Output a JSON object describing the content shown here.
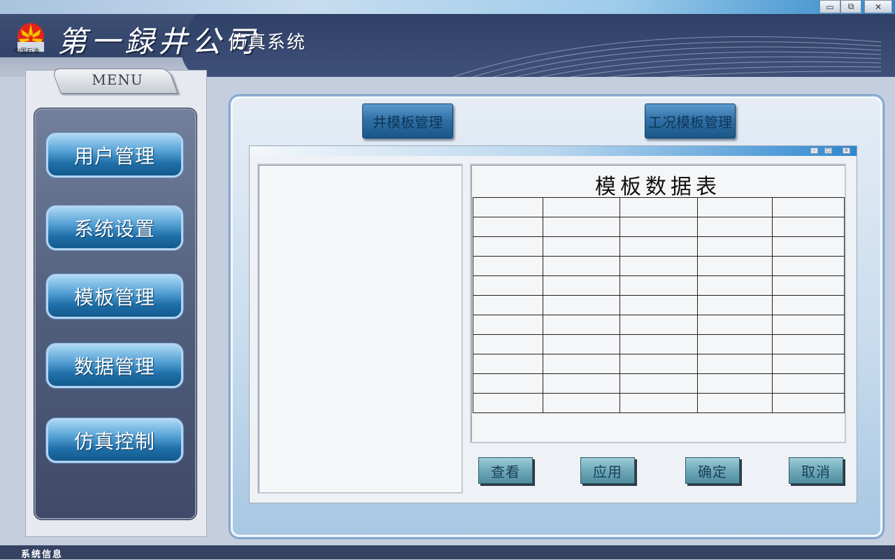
{
  "window": {
    "minimize": "▭",
    "restore": "⧉",
    "close": "✕"
  },
  "header": {
    "logo_text": "中国石油",
    "company": "第一録井公司",
    "subtitle": "仿真系统"
  },
  "menu": {
    "tab_label": "MENU",
    "items": [
      {
        "label": "用户管理"
      },
      {
        "label": "系统设置"
      },
      {
        "label": "模板管理"
      },
      {
        "label": "数据管理"
      },
      {
        "label": "仿真控制"
      }
    ]
  },
  "main": {
    "well_template_button": "井模板管理",
    "condition_template_button": "工况模板管理",
    "inner_window": {
      "min": "–",
      "max": "□",
      "close": "x"
    },
    "table": {
      "title": "模板数据表",
      "rows": 11,
      "cols": 5
    },
    "actions": {
      "view": "查看",
      "apply": "应用",
      "confirm": "确定",
      "cancel": "取消"
    }
  },
  "status": {
    "label": "系统信息"
  },
  "colors": {
    "header_dark": "#33446a",
    "menu_button": "#1f6fa9",
    "main_panel": "#c9dcee",
    "status_bar": "#354262"
  }
}
